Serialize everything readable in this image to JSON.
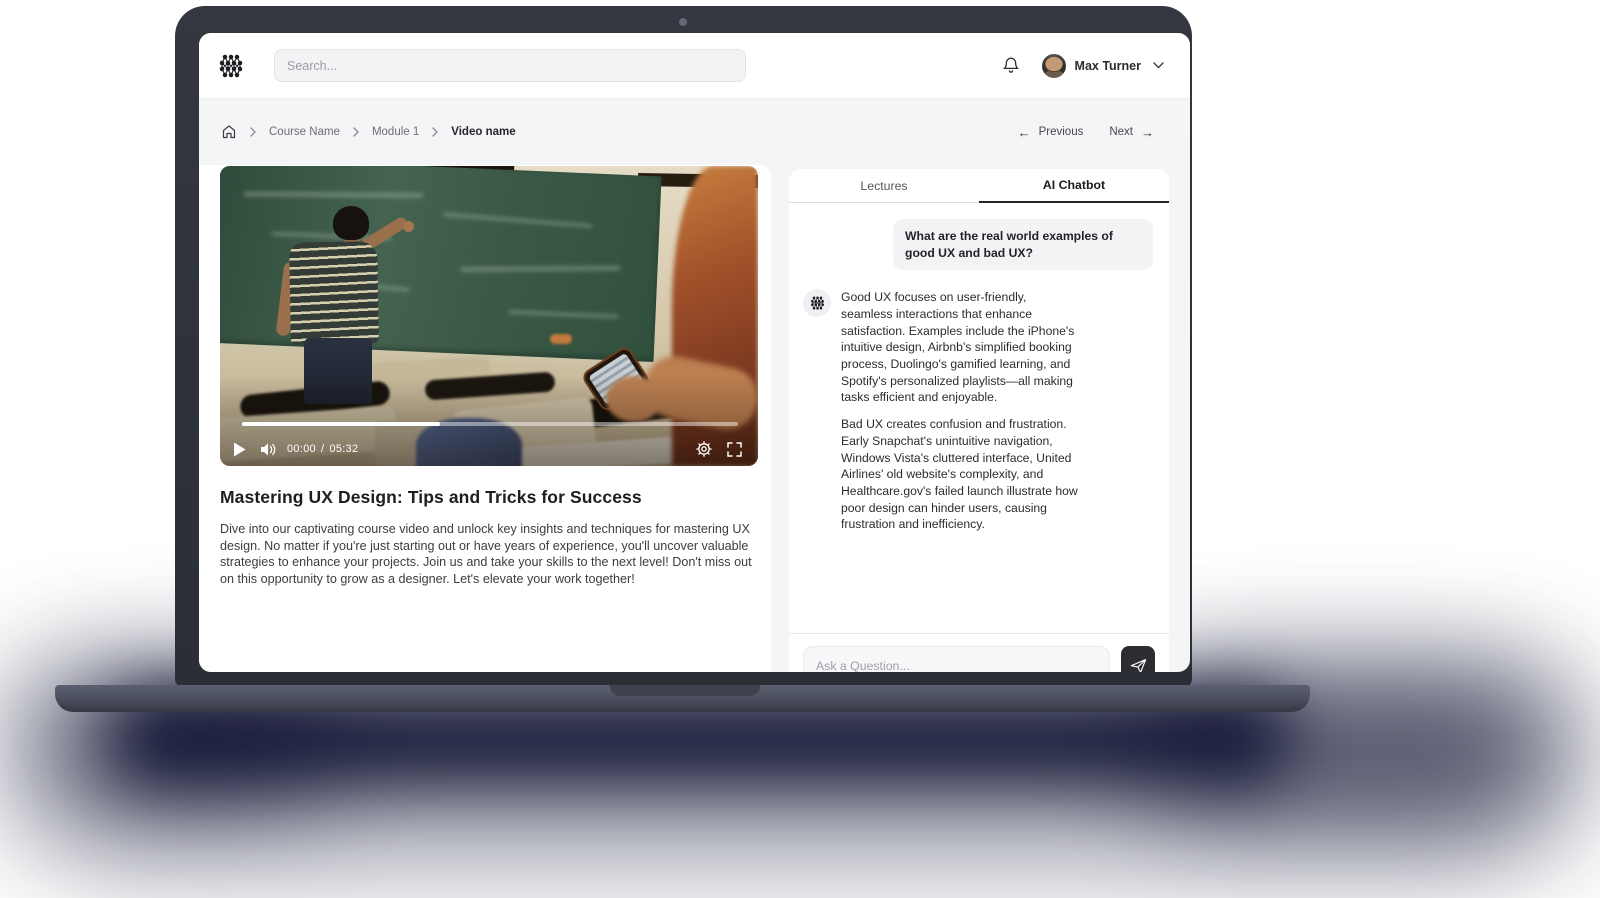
{
  "header": {
    "search_placeholder": "Search...",
    "user_name": "Max Turner"
  },
  "breadcrumb": {
    "course": "Course Name",
    "module": "Module 1",
    "current": "Video name",
    "previous_label": "Previous",
    "next_label": "Next",
    "prev_arrow": "←",
    "next_arrow": "→"
  },
  "video": {
    "current_time": "00:00",
    "time_separator": "/",
    "duration": "05:32",
    "progress_percent": 40
  },
  "lesson": {
    "title": "Mastering UX Design: Tips and Tricks for Success",
    "description": "Dive into our captivating course video and unlock key insights and techniques for mastering UX design. No matter if you're just starting out or have years of experience, you'll uncover valuable strategies to enhance your projects. Join us and take your skills to the next level! Don't miss out on this opportunity to grow as a designer. Let's elevate your work together!"
  },
  "panel": {
    "tabs": [
      {
        "label": "Lectures",
        "active": false
      },
      {
        "label": "AI Chatbot",
        "active": true
      }
    ],
    "chat": {
      "user_question": "What are the real world examples of good UX and bad UX?",
      "ai_paragraphs": [
        "Good UX focuses on user-friendly, seamless interactions that enhance satisfaction. Examples include the iPhone's intuitive design, Airbnb's simplified booking process, Duolingo's gamified learning, and Spotify's personalized playlists—all making tasks efficient and enjoyable.",
        "Bad UX creates confusion and frustration. Early Snapchat's unintuitive navigation, Windows Vista's cluttered interface, United Airlines' old website's complexity, and Healthcare.gov's failed launch illustrate how poor design can hinder users, causing frustration and inefficiency."
      ],
      "input_placeholder": "Ask a Question..."
    }
  },
  "icons": {
    "logo": "lattice-network-logo",
    "notification": "bell",
    "home": "house-outline",
    "settings": "gear",
    "fullscreen": "corner-brackets",
    "send": "paper-plane"
  },
  "colors": {
    "app_bg": "#f4f5f7",
    "card_bg": "#ffffff",
    "dark_button": "#2b2d31",
    "laptop_frame": "#2f323a",
    "shadow_navy": "#0d1030"
  }
}
